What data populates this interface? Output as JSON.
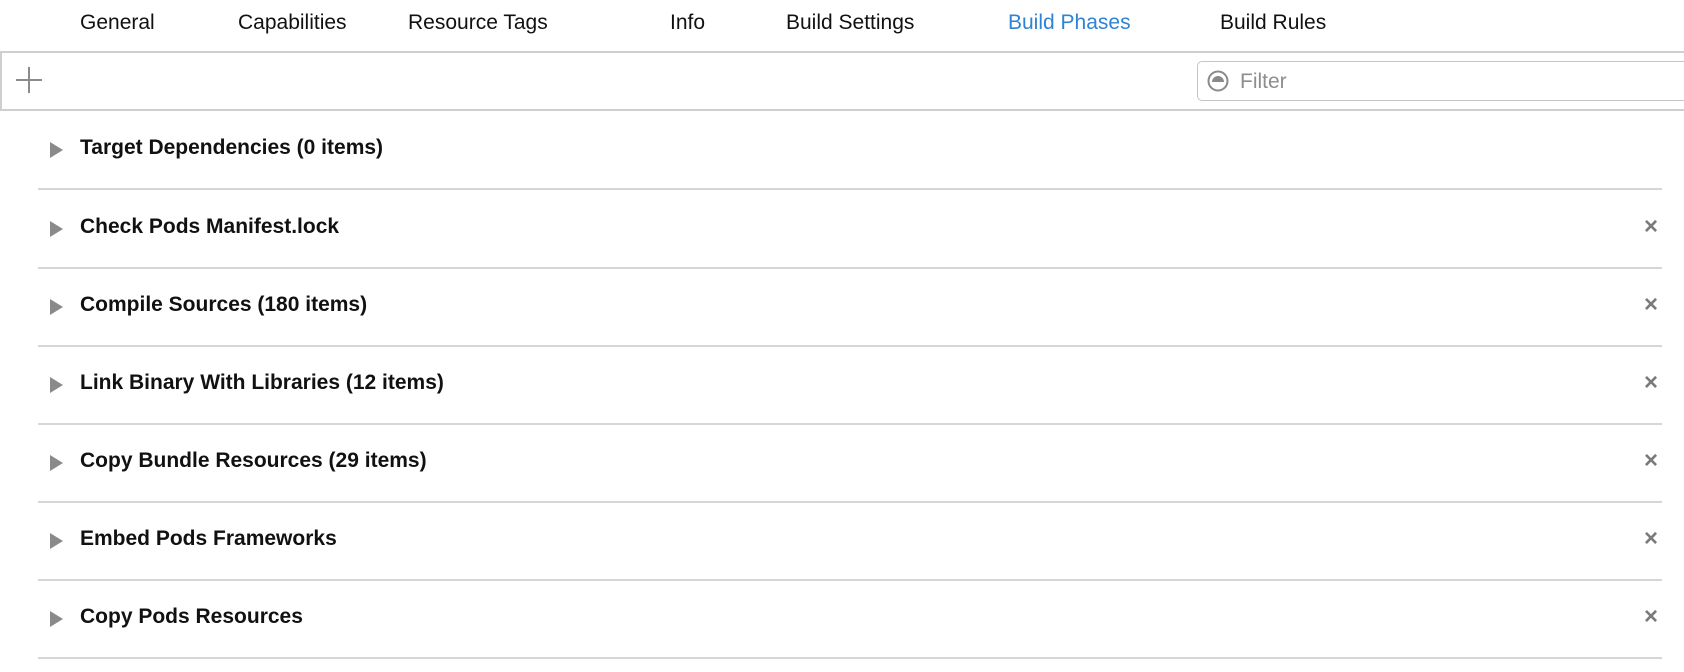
{
  "tabs": [
    {
      "label": "General"
    },
    {
      "label": "Capabilities"
    },
    {
      "label": "Resource Tags"
    },
    {
      "label": "Info"
    },
    {
      "label": "Build Settings"
    },
    {
      "label": "Build Phases",
      "active": true
    },
    {
      "label": "Build Rules"
    }
  ],
  "toolbar": {
    "add_icon": "plus-icon",
    "filter_placeholder": "Filter",
    "filter_icon": "filter-circle-icon"
  },
  "phases": [
    {
      "title": "Target Dependencies (0 items)",
      "removable": false
    },
    {
      "title": "Check Pods Manifest.lock",
      "removable": true
    },
    {
      "title": "Compile Sources (180 items)",
      "removable": true
    },
    {
      "title": "Link Binary With Libraries (12 items)",
      "removable": true
    },
    {
      "title": "Copy Bundle Resources (29 items)",
      "removable": true
    },
    {
      "title": "Embed Pods Frameworks",
      "removable": true
    },
    {
      "title": "Copy Pods Resources",
      "removable": true
    }
  ],
  "colors": {
    "accent": "#2f83d4",
    "separator": "#d6d6d6",
    "icon": "#8a8a8a"
  }
}
